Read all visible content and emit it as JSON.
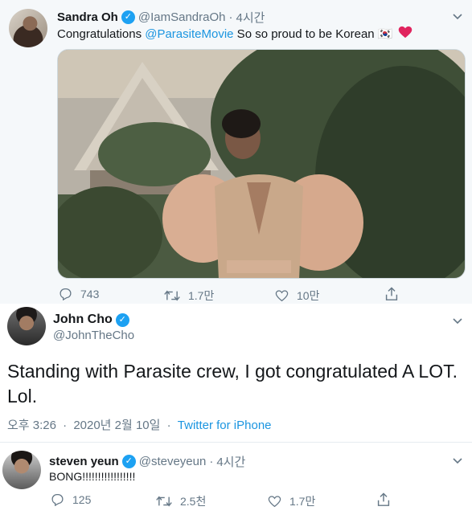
{
  "tweet1": {
    "name": "Sandra Oh",
    "handle": "@IamSandraOh",
    "time": "4시간",
    "text_prefix": "Congratulations ",
    "mention": "@ParasiteMovie",
    "text_suffix": " So so proud to be Korean 🇰🇷",
    "reply_count": "743",
    "retweet_count": "1.7만",
    "like_count": "10만"
  },
  "tweet2": {
    "name": "John Cho",
    "handle": "@JohnTheCho",
    "text": "Standing with Parasite crew, I got congratulated A LOT. Lol.",
    "time_of_day": "오후 3:26",
    "date": "2020년 2월 10일",
    "source": "Twitter for iPhone"
  },
  "tweet3": {
    "name": "steven yeun",
    "handle": "@steveyeun",
    "time": "4시간",
    "text": "BONG!!!!!!!!!!!!!!!!!",
    "reply_count": "125",
    "retweet_count": "2.5천",
    "like_count": "1.7만"
  },
  "icons": {
    "verified": "verified-badge-icon",
    "reply": "reply-icon",
    "retweet": "retweet-icon",
    "like": "heart-icon",
    "share": "share-icon",
    "more": "chevron-down-icon"
  },
  "colors": {
    "link": "#1b95e0",
    "verified": "#1da1f2",
    "heart": "#e0245e",
    "muted": "#657786"
  }
}
